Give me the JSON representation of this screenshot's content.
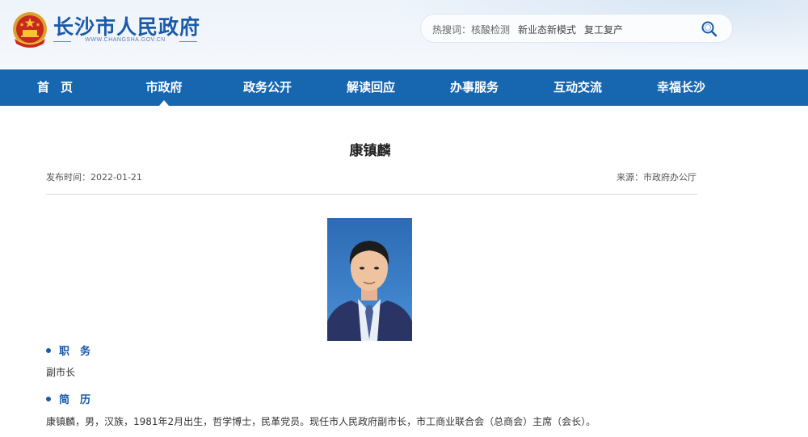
{
  "header": {
    "site_title": "长沙市人民政府",
    "site_url": "WWW.CHANGSHA.GOV.CN",
    "search": {
      "hot_label": "热搜词：核酸检测",
      "hot_words": [
        "核酸检测",
        "新业态新模式",
        "复工复产"
      ]
    }
  },
  "nav": {
    "items": [
      {
        "label": "首页",
        "active": false
      },
      {
        "label": "市政府",
        "active": true
      },
      {
        "label": "政务公开",
        "active": false
      },
      {
        "label": "解读回应",
        "active": false
      },
      {
        "label": "办事服务",
        "active": false
      },
      {
        "label": "互动交流",
        "active": false
      },
      {
        "label": "幸福长沙",
        "active": false
      }
    ]
  },
  "article": {
    "title": "康镇麟",
    "publish_time": "发布时间：2022-01-21",
    "source": "来源：市政府办公厅",
    "sections": [
      {
        "heading": "职　务",
        "text": "副市长"
      },
      {
        "heading": "简　历",
        "text": "康镇麟，男，汉族，1981年2月出生，哲学博士，民革党员。现任市人民政府副市长，市工商业联合会（总商会）主席（会长）。"
      }
    ]
  },
  "colors": {
    "nav_bg": "#1666b0",
    "brand_blue": "#1a5aa8"
  }
}
